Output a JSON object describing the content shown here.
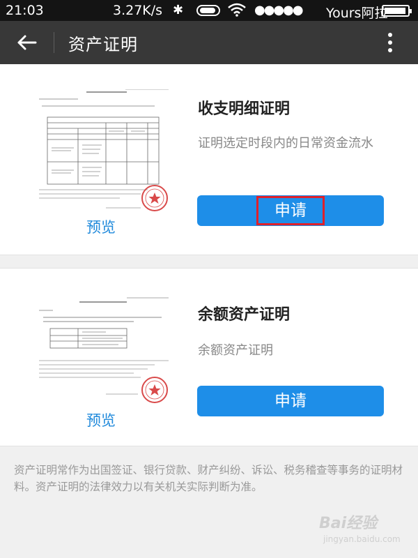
{
  "status_bar": {
    "time": "21:03",
    "speed": "3.27K/s",
    "signal": "●●●●●",
    "carrier": "Yours阿拉"
  },
  "toolbar": {
    "title": "资产证明"
  },
  "cards": [
    {
      "title": "收支明细证明",
      "description": "证明选定时段内的日常资金流水",
      "preview_label": "预览",
      "apply_label": "申请"
    },
    {
      "title": "余额资产证明",
      "description": "余额资产证明",
      "preview_label": "预览",
      "apply_label": "申请"
    }
  ],
  "footer_note": "资产证明常作为出国签证、银行贷款、财产纠纷、诉讼、税务稽查等事务的证明材料。资产证明的法律效力以有关机关实际判断为准。",
  "watermark": {
    "text": "Bai经验",
    "url": "jingyan.baidu.com"
  },
  "colors": {
    "accent": "#1e8ee8",
    "link": "#1f89db",
    "toolbar_bg": "#383838",
    "status_bg": "#141414",
    "highlight": "#e0202a",
    "stamp": "#d94a4a"
  },
  "icons": [
    "back-arrow-icon",
    "more-vert-icon",
    "bluetooth-icon",
    "wifi-icon",
    "battery-icon"
  ]
}
